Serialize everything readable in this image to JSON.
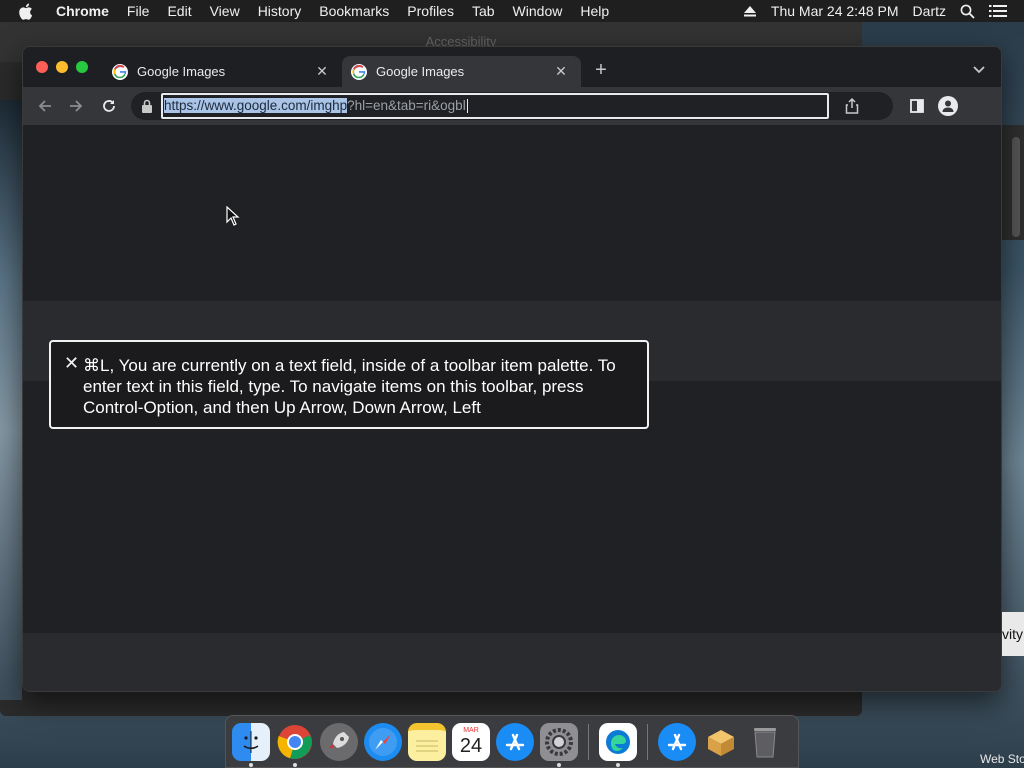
{
  "menubar": {
    "app": "Chrome",
    "menus": [
      "File",
      "Edit",
      "View",
      "History",
      "Bookmarks",
      "Profiles",
      "Tab",
      "Window",
      "Help"
    ],
    "datetime": "Thu Mar 24  2:48 PM",
    "user": "Dartz"
  },
  "background_window": {
    "title": "Accessibility"
  },
  "tabs": [
    {
      "label": "Google Images",
      "active": false
    },
    {
      "label": "Google Images",
      "active": true
    }
  ],
  "omnibox": {
    "url_selected": "https://www.google.com/imghp",
    "url_rest": "?hl=en&tab=ri&ogbl"
  },
  "voiceover": {
    "text": "⌘L, You are currently on a text field, inside of a toolbar item palette. To enter text in this field, type.  To navigate items on this toolbar, press Control-Option, and then Up Arrow, Down Arrow, Left"
  },
  "edge_text": {
    "right_label": "vity",
    "bottom_right": "Web Sto"
  },
  "dock": {
    "calendar_month": "MAR",
    "calendar_day": "24"
  },
  "colors": {
    "chrome_dark": "#202124",
    "tab_active": "#35363a",
    "url_selection": "#aac4e8",
    "traffic_red": "#ff5f57",
    "traffic_yellow": "#febc2e",
    "traffic_green": "#28c840"
  }
}
